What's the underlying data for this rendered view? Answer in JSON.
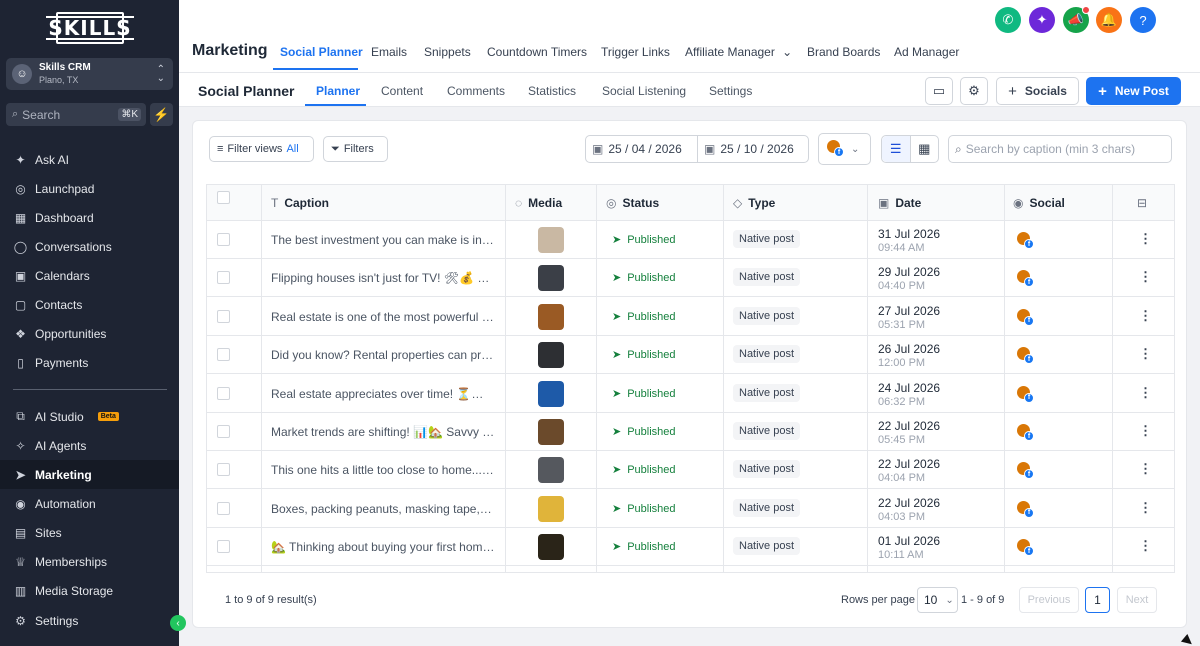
{
  "sidebar": {
    "logo": "SKILLS",
    "account": {
      "name": "Skills CRM",
      "location": "Plano, TX"
    },
    "search": {
      "placeholder": "Search",
      "shortcut": "⌘K"
    },
    "items_top": [
      {
        "label": "Ask AI",
        "icon": "ask-ai-icon",
        "glyph": "✦"
      },
      {
        "label": "Launchpad",
        "icon": "launchpad-icon",
        "glyph": "◎"
      },
      {
        "label": "Dashboard",
        "icon": "dashboard-icon",
        "glyph": "▦"
      },
      {
        "label": "Conversations",
        "icon": "conversations-icon",
        "glyph": "◯"
      },
      {
        "label": "Calendars",
        "icon": "calendar-icon",
        "glyph": "▣"
      },
      {
        "label": "Contacts",
        "icon": "contacts-icon",
        "glyph": "▢"
      },
      {
        "label": "Opportunities",
        "icon": "opportunities-icon",
        "glyph": "❖"
      },
      {
        "label": "Payments",
        "icon": "payments-icon",
        "glyph": "▯"
      }
    ],
    "items_bottom": [
      {
        "label": "AI Studio",
        "icon": "ai-studio-icon",
        "glyph": "⧉",
        "badge": "Beta"
      },
      {
        "label": "AI Agents",
        "icon": "ai-agents-icon",
        "glyph": "✧"
      },
      {
        "label": "Marketing",
        "icon": "marketing-icon",
        "glyph": "➤",
        "active": true
      },
      {
        "label": "Automation",
        "icon": "automation-icon",
        "glyph": "◉"
      },
      {
        "label": "Sites",
        "icon": "sites-icon",
        "glyph": "▤"
      },
      {
        "label": "Memberships",
        "icon": "memberships-icon",
        "glyph": "♕"
      },
      {
        "label": "Media Storage",
        "icon": "media-storage-icon",
        "glyph": "▥"
      }
    ],
    "settings_label": "Settings"
  },
  "topbar": {
    "title": "Marketing",
    "tabs": [
      "Social Planner",
      "Emails",
      "Snippets",
      "Countdown Timers",
      "Trigger Links",
      "Affiliate Manager",
      "Brand Boards",
      "Ad Manager"
    ],
    "active_tab": "Social Planner"
  },
  "subbar": {
    "title": "Social Planner",
    "tabs": [
      "Planner",
      "Content",
      "Comments",
      "Statistics",
      "Social Listening",
      "Settings"
    ],
    "socials_label": "Socials",
    "new_post_label": "New Post"
  },
  "filters": {
    "filter_views_label": "Filter views",
    "filter_views_value": "All",
    "filters_label": "Filters",
    "date_from": "25 / 04 / 2026",
    "date_to": "25 / 10 / 2026",
    "search_placeholder": "Search by caption (min 3 chars)"
  },
  "table": {
    "headers": [
      "Caption",
      "Media",
      "Status",
      "Type",
      "Date",
      "Social"
    ],
    "rows": [
      {
        "caption": "The best investment you can make is in real estate",
        "status": "Published",
        "type": "Native post",
        "date": "31 Jul 2026",
        "time": "09:44 AM",
        "thumb": "#c9b8a3"
      },
      {
        "caption": "Flipping houses isn't just for TV! 🛠💰 With the right plan",
        "status": "Published",
        "type": "Native post",
        "date": "29 Jul 2026",
        "time": "04:40 PM",
        "thumb": "#3b3f47"
      },
      {
        "caption": "Real estate is one of the most powerful ways to build wealth",
        "status": "Published",
        "type": "Native post",
        "date": "27 Jul 2026",
        "time": "05:31 PM",
        "thumb": "#9a5a24"
      },
      {
        "caption": "Did you know? Rental properties can provide steady income",
        "status": "Published",
        "type": "Native post",
        "date": "26 Jul 2026",
        "time": "12:00 PM",
        "thumb": "#2d2f33"
      },
      {
        "caption": "Real estate appreciates over time! ⏳💰 Buy now",
        "status": "Published",
        "type": "Native post",
        "date": "24 Jul 2026",
        "time": "06:32 PM",
        "thumb": "#1e5aa8"
      },
      {
        "caption": "Market trends are shifting! 📊🏡 Savvy investors know",
        "status": "Published",
        "type": "Native post",
        "date": "22 Jul 2026",
        "time": "05:45 PM",
        "thumb": "#6b4a2b"
      },
      {
        "caption": "This one hits a little too close to home... 😅",
        "status": "Published",
        "type": "Native post",
        "date": "22 Jul 2026",
        "time": "04:04 PM",
        "thumb": "#55585e"
      },
      {
        "caption": "Boxes, packing peanuts, masking tape, and more",
        "status": "Published",
        "type": "Native post",
        "date": "22 Jul 2026",
        "time": "04:03 PM",
        "thumb": "#e0b43a"
      },
      {
        "caption": "🏡 Thinking about buying your first home? Here's what to know",
        "status": "Published",
        "type": "Native post",
        "date": "01 Jul 2026",
        "time": "10:11 AM",
        "thumb": "#2a2418"
      }
    ]
  },
  "footer": {
    "results": "1 to 9 of 9 result(s)",
    "rows_per_page_label": "Rows per page",
    "rows_per_page_value": "10",
    "range": "1 - 9 of 9",
    "previous": "Previous",
    "page": "1",
    "next": "Next"
  },
  "colors": {
    "accent": "#1d73f0",
    "sidebar": "#1e2433",
    "published": "#15803d"
  }
}
